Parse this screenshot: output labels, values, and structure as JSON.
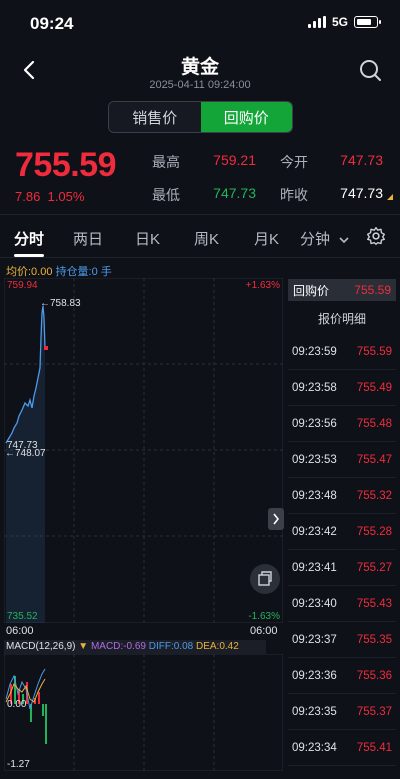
{
  "status": {
    "time": "09:24",
    "network": "5G"
  },
  "header": {
    "title": "黄金",
    "datetime": "2025-04-11 09:24:00"
  },
  "segment": {
    "sell": "销售价",
    "buy": "回购价",
    "active": "buy"
  },
  "quote": {
    "price": "755.59",
    "change": "7.86",
    "change_pct": "1.05%",
    "high_label": "最高",
    "high": "759.21",
    "open_label": "今开",
    "open": "747.73",
    "low_label": "最低",
    "low": "747.73",
    "prev_label": "昨收",
    "prev": "747.73"
  },
  "tabs": [
    "分时",
    "两日",
    "日K",
    "周K",
    "月K",
    "分钟"
  ],
  "info": {
    "avg": "均价:0.00",
    "hold": "持仓量:0 手"
  },
  "chart": {
    "top_price": "759.94",
    "top_pct": "+1.63%",
    "bottom_price": "735.52",
    "bottom_pct": "-1.63%",
    "time_left": "06:00",
    "time_right": "06:00",
    "label_high": "←758.83",
    "label_base": "747.73",
    "label_low": "←748.07"
  },
  "macd": {
    "title": "MACD(12,26,9)",
    "macd": "MACD:-0.69",
    "diff": "DIFF:0.08",
    "dea": "DEA:0.42",
    "zero": "0.00",
    "min": "-1.27"
  },
  "side": {
    "head_label": "回购价",
    "head_price": "755.59",
    "title": "报价明细",
    "rows": [
      {
        "t": "09:23:59",
        "p": "755.59"
      },
      {
        "t": "09:23:58",
        "p": "755.49"
      },
      {
        "t": "09:23:56",
        "p": "755.48"
      },
      {
        "t": "09:23:53",
        "p": "755.47"
      },
      {
        "t": "09:23:48",
        "p": "755.32"
      },
      {
        "t": "09:23:42",
        "p": "755.28"
      },
      {
        "t": "09:23:41",
        "p": "755.27"
      },
      {
        "t": "09:23:40",
        "p": "755.43"
      },
      {
        "t": "09:23:37",
        "p": "755.35"
      },
      {
        "t": "09:23:36",
        "p": "755.36"
      },
      {
        "t": "09:23:35",
        "p": "755.37"
      },
      {
        "t": "09:23:34",
        "p": "755.41"
      }
    ]
  },
  "colors": {
    "up": "#f02c3c",
    "down": "#24b35a",
    "accent": "#13a538",
    "line": "#4d9bea"
  }
}
